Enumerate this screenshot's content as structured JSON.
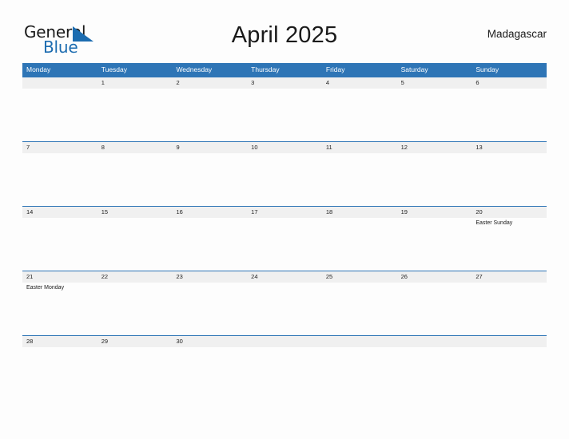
{
  "logo": {
    "word_top": "General",
    "word_bottom": "Blue",
    "flag_icon": "blue-flag-triangle-icon",
    "accent_color": "#1c6cb0"
  },
  "header": {
    "title": "April 2025",
    "country": "Madagascar"
  },
  "theme": {
    "header_blue": "#2e75b6",
    "daynum_band_gray": "#f0f0f0",
    "page_background": "#fdfdfd",
    "text_color": "#1a1a1a"
  },
  "calendar": {
    "month": "April",
    "year": "2025",
    "weekday_headers": [
      "Monday",
      "Tuesday",
      "Wednesday",
      "Thursday",
      "Friday",
      "Saturday",
      "Sunday"
    ],
    "weeks": [
      {
        "days": [
          {
            "number": "",
            "event": ""
          },
          {
            "number": "1",
            "event": ""
          },
          {
            "number": "2",
            "event": ""
          },
          {
            "number": "3",
            "event": ""
          },
          {
            "number": "4",
            "event": ""
          },
          {
            "number": "5",
            "event": ""
          },
          {
            "number": "6",
            "event": ""
          }
        ]
      },
      {
        "days": [
          {
            "number": "7",
            "event": ""
          },
          {
            "number": "8",
            "event": ""
          },
          {
            "number": "9",
            "event": ""
          },
          {
            "number": "10",
            "event": ""
          },
          {
            "number": "11",
            "event": ""
          },
          {
            "number": "12",
            "event": ""
          },
          {
            "number": "13",
            "event": ""
          }
        ]
      },
      {
        "days": [
          {
            "number": "14",
            "event": ""
          },
          {
            "number": "15",
            "event": ""
          },
          {
            "number": "16",
            "event": ""
          },
          {
            "number": "17",
            "event": ""
          },
          {
            "number": "18",
            "event": ""
          },
          {
            "number": "19",
            "event": ""
          },
          {
            "number": "20",
            "event": "Easter Sunday"
          }
        ]
      },
      {
        "days": [
          {
            "number": "21",
            "event": "Easter Monday"
          },
          {
            "number": "22",
            "event": ""
          },
          {
            "number": "23",
            "event": ""
          },
          {
            "number": "24",
            "event": ""
          },
          {
            "number": "25",
            "event": ""
          },
          {
            "number": "26",
            "event": ""
          },
          {
            "number": "27",
            "event": ""
          }
        ]
      },
      {
        "days": [
          {
            "number": "28",
            "event": ""
          },
          {
            "number": "29",
            "event": ""
          },
          {
            "number": "30",
            "event": ""
          },
          {
            "number": "",
            "event": ""
          },
          {
            "number": "",
            "event": ""
          },
          {
            "number": "",
            "event": ""
          },
          {
            "number": "",
            "event": ""
          }
        ]
      }
    ]
  }
}
